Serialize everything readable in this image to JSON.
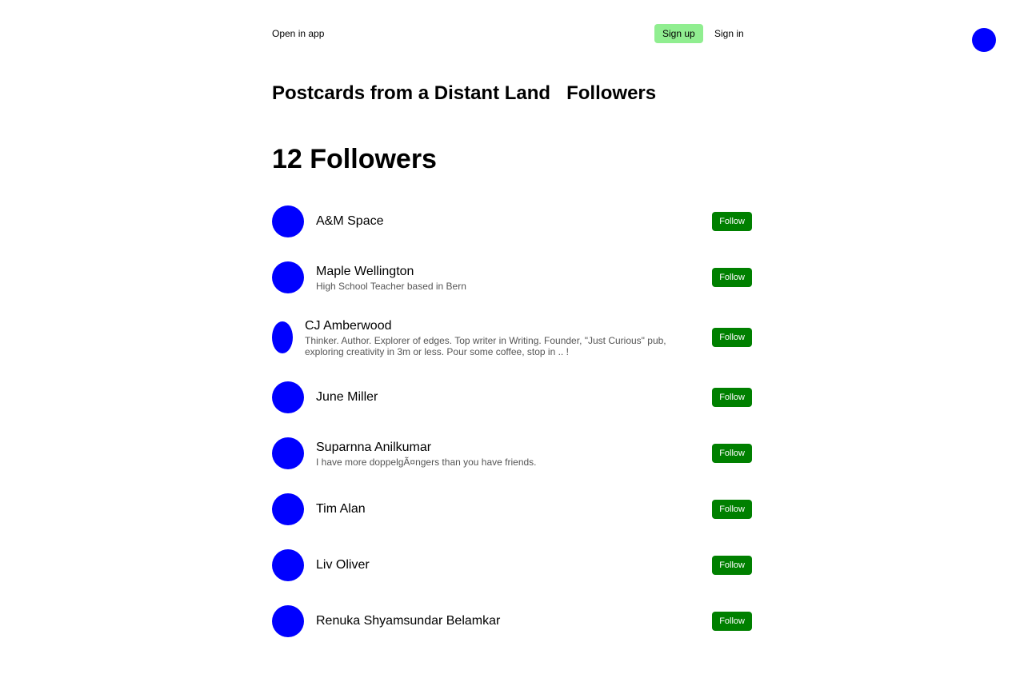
{
  "colors": {
    "avatar": "#0000ff",
    "signup_bg": "#90ee90",
    "follow_bg": "#008000",
    "follow_text": "#ffffff",
    "bio_text": "#555555"
  },
  "topbar": {
    "open_in_app": "Open in app",
    "sign_up": "Sign up",
    "sign_in": "Sign in"
  },
  "header": {
    "publication": "Postcards from a Distant Land",
    "section": "Followers"
  },
  "count_title": "12 Followers",
  "followers": [
    {
      "name": "A&M Space",
      "bio": ""
    },
    {
      "name": "Maple Wellington",
      "bio": "High School Teacher based in Bern"
    },
    {
      "name": "CJ Amberwood",
      "bio": "Thinker. Author. Explorer of edges. Top writer in Writing. Founder, \"Just Curious\" pub, exploring creativity in 3m or less. Pour some coffee, stop in .. !"
    },
    {
      "name": "June Miller",
      "bio": ""
    },
    {
      "name": "Suparnna Anilkumar",
      "bio": "I have more doppelgÃ¤ngers than you have friends."
    },
    {
      "name": "Tim Alan",
      "bio": ""
    },
    {
      "name": "Liv Oliver",
      "bio": ""
    },
    {
      "name": "Renuka Shyamsundar Belamkar",
      "bio": ""
    }
  ],
  "follow_label": "Follow"
}
